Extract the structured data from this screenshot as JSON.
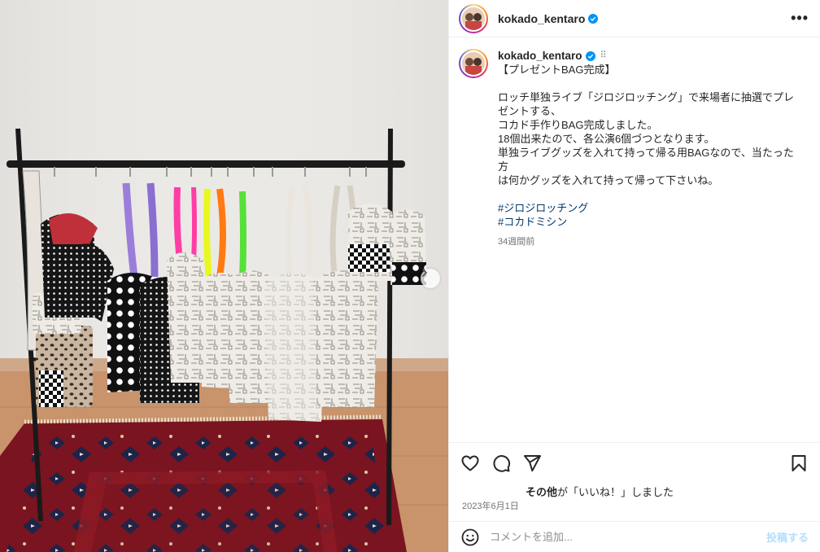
{
  "header": {
    "username": "kokado_kentaro",
    "more_icon": "more-horizontal-icon"
  },
  "caption": {
    "username": "kokado_kentaro",
    "translate_icon": "drag-dots-icon",
    "title": "【プレゼントBAG完成】",
    "body": "ロッチ単独ライブ「ジロジロッチング」で来場者に抽選でプレ\nゼントする、\nコカド手作りBAG完成しました。\n18個出来たので、各公演6個づつとなります。\n単独ライブグッズを入れて持って帰る用BAGなので、当たった方\nは何かグッズを入れて持って帰って下さいね。",
    "hashtags": [
      "#ジロジロッチング",
      "#コカドミシン"
    ],
    "time_ago": "34週間前"
  },
  "actions": {
    "like_icon": "heart-icon",
    "comment_icon": "comment-icon",
    "share_icon": "send-icon",
    "save_icon": "bookmark-icon"
  },
  "likes": {
    "who": "その他",
    "text": "が「いいね！」しました"
  },
  "date": "2023年6月1日",
  "comment_box": {
    "emoji_icon": "emoji-icon",
    "placeholder": "コメントを追加...",
    "post_label": "投稿する"
  },
  "media": {
    "next_icon": "chevron-right-icon"
  },
  "colors": {
    "link": "#00376b",
    "verified": "#0095f6",
    "post_disabled": "#b2dffc",
    "secondary_text": "#737373"
  }
}
